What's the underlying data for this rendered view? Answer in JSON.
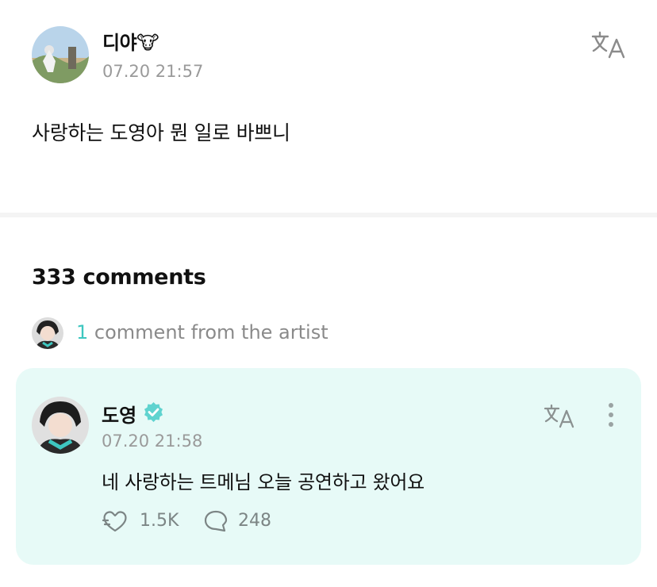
{
  "post": {
    "author": "디야🐮",
    "timestamp": "07.20 21:57",
    "body": "사랑하는 도영아 뭔 일로 바쁘니"
  },
  "comments": {
    "title": "333 comments",
    "artist_count": "1",
    "artist_text": " comment from the artist"
  },
  "artist_comment": {
    "author": "도영",
    "timestamp": "07.20 21:58",
    "body": "네 사랑하는 트메님 오늘 공연하고 왔어요",
    "likes": "1.5K",
    "replies": "248"
  },
  "colors": {
    "accent": "#3ec7c0",
    "card_background": "#e7faf7",
    "muted_text": "#9a9a9a"
  },
  "icons": [
    "avatar",
    "translate-icon",
    "verified-badge-icon",
    "more-vertical-icon",
    "heart-like-icon",
    "comment-bubble-icon"
  ]
}
